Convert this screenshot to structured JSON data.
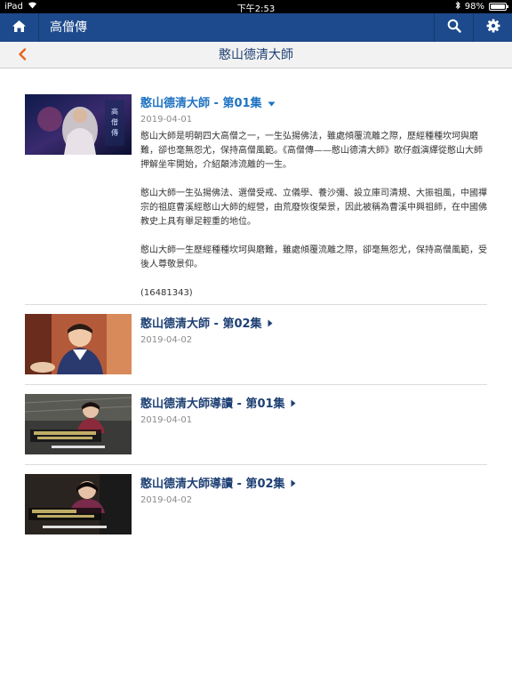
{
  "status_bar": {
    "device": "iPad",
    "time": "下午2:53",
    "battery": "98%",
    "battery_level": 0.98
  },
  "navbar": {
    "title": "高僧傳",
    "home_icon": "home-icon",
    "search_icon": "search-icon",
    "settings_icon": "gear-icon"
  },
  "subheader": {
    "title": "憨山德清大師",
    "back_icon": "chevron-left-icon"
  },
  "episodes": [
    {
      "title": "憨山德清大師 - 第01集",
      "date": "2019-04-01",
      "expanded": true,
      "description": [
        "憨山大師是明朝四大高僧之一，一生弘揚佛法，雖處傾覆流離之際，歷經種種坎坷與磨難，卻也毫無怨尤，保持高僧風範。《高僧傳——憨山德清大師》歌仔戲演繹從憨山大師押解坐牢開始，介紹顛沛流離的一生。",
        "憨山大師一生弘揚佛法、選僧受戒、立儀學、養沙彌、設立庫司清規、大振祖風，中國禪宗的祖庭曹溪經憨山大師的經營，由荒廢恢復榮景，因此被稱為曹溪中興祖師，在中國佛教史上具有舉足輕重的地位。",
        "憨山大師一生歷經種種坎坷與磨難，雖處傾覆流離之際，卻毫無怨尤，保持高僧風範，受後人尊敬景仰。"
      ],
      "code": "(16481343)"
    },
    {
      "title": "憨山德清大師 - 第02集",
      "date": "2019-04-02",
      "expanded": false
    },
    {
      "title": "憨山德清大師導讀 - 第01集",
      "date": "2019-04-01",
      "expanded": false
    },
    {
      "title": "憨山德清大師導讀 - 第02集",
      "date": "2019-04-02",
      "expanded": false
    }
  ],
  "colors": {
    "nav_bg": "#1d4a8c",
    "accent_orange": "#e8641e",
    "title_blue": "#1d3f73",
    "active_blue": "#1e73c2"
  }
}
